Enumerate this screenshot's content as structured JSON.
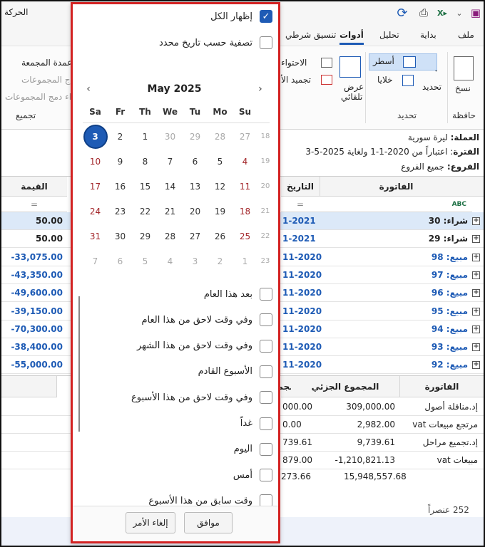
{
  "app": {
    "title_fragment": "الحركة"
  },
  "tabs": [
    "ملف",
    "بداية",
    "تحليل",
    "أدوات",
    "تنسيق شرطي"
  ],
  "active_tab": "أدوات",
  "ribbon": {
    "copy": "نسخ",
    "copy_group": "حافظة",
    "select": "تحديد",
    "rows": "أسطر",
    "cells": "خلايا",
    "select_group": "تحديد",
    "autoview_line1": "عرض",
    "autoview_line2": "تلقائي",
    "contain": "الاحتواء",
    "freeze": "تجميد الأ",
    "group_col": "عمدة المجمعة",
    "collapse_groups": "ج المجموعات",
    "unmerge_groups": "اء دمج المجموعات",
    "group_label": "تجميع"
  },
  "info": {
    "currency_label": "العملة:",
    "currency_value": "ليرة سورية",
    "period_label": "الفترة",
    "period_value": ": اعتباراً من 2020-1-1 ولغاية 2025-5-3",
    "branches_label": "الفروع:",
    "branches_value": "جميع الفروع"
  },
  "grid": {
    "headers": {
      "invoice": "الفاتورة",
      "date": "التاريخ",
      "value": "القيمة"
    },
    "filter_symbol": "=",
    "rows": [
      {
        "invoice": "شراء: 30",
        "date": "1-2021",
        "value": "50.00",
        "selected": true,
        "kind": "buy"
      },
      {
        "invoice": "شراء: 29",
        "date": "1-2021",
        "value": "50.00",
        "selected": false,
        "kind": "buy"
      },
      {
        "invoice": "مبيع: 98",
        "date": "11-2020",
        "value": "-33,075.00",
        "selected": false,
        "kind": "sale"
      },
      {
        "invoice": "مبيع: 97",
        "date": "11-2020",
        "value": "-43,350.00",
        "selected": false,
        "kind": "sale"
      },
      {
        "invoice": "مبيع: 96",
        "date": "11-2020",
        "value": "-49,600.00",
        "selected": false,
        "kind": "sale"
      },
      {
        "invoice": "مبيع: 95",
        "date": "11-2020",
        "value": "-39,150.00",
        "selected": false,
        "kind": "sale"
      },
      {
        "invoice": "مبيع: 94",
        "date": "11-2020",
        "value": "-70,300.00",
        "selected": false,
        "kind": "sale"
      },
      {
        "invoice": "مبيع: 93",
        "date": "11-2020",
        "value": "-38,400.00",
        "selected": false,
        "kind": "sale"
      },
      {
        "invoice": "مبيع: 92",
        "date": "11-2020",
        "value": "-55,000.00",
        "selected": false,
        "kind": "sale"
      }
    ]
  },
  "summary": {
    "headers": {
      "invoice": "الفاتورة",
      "subtotal": "المجموع الجزئي",
      "total_frag": "مجم"
    },
    "rows": [
      {
        "invoice": "إد.مناقلة أصول",
        "subtotal": "309,000.00",
        "total": "000.00"
      },
      {
        "invoice": "مرتجع مبيعات vat",
        "subtotal": "2,982.00",
        "total": "0.00"
      },
      {
        "invoice": "إد.تجميع مراحل",
        "subtotal": "9,739.61",
        "total": "739.61"
      },
      {
        "invoice": "مبيعات vat",
        "subtotal": "-1,210,821.13",
        "total": "879.00"
      }
    ],
    "grand_subtotal": "15,948,557.68",
    "grand_total": "273.66"
  },
  "status": "252 عنصراً",
  "popup": {
    "show_all": "إظهار الكل",
    "filter_by_date": "تصفية حسب تاريخ محدد",
    "calendar": {
      "month": "May 2025",
      "days_of_week": [
        "Sa",
        "Fr",
        "Th",
        "We",
        "Tu",
        "Mo",
        "Su"
      ],
      "weeks": [
        {
          "wk": "18",
          "days": [
            "3",
            "2",
            "1",
            "30",
            "29",
            "28",
            "27"
          ]
        },
        {
          "wk": "19",
          "days": [
            "10",
            "9",
            "8",
            "7",
            "6",
            "5",
            "4"
          ]
        },
        {
          "wk": "20",
          "days": [
            "17",
            "16",
            "15",
            "14",
            "13",
            "12",
            "11"
          ]
        },
        {
          "wk": "21",
          "days": [
            "24",
            "23",
            "22",
            "21",
            "20",
            "19",
            "18"
          ]
        },
        {
          "wk": "22",
          "days": [
            "31",
            "30",
            "29",
            "28",
            "27",
            "26",
            "25"
          ]
        },
        {
          "wk": "23",
          "days": [
            "7",
            "6",
            "5",
            "4",
            "3",
            "2",
            "1"
          ]
        }
      ],
      "selected_day": "3"
    },
    "options": [
      "بعد هذا العام",
      "وفي وقت لاحق من هذا العام",
      "وفي وقت لاحق من هذا الشهر",
      "الأسبوع القادم",
      "وفي وقت لاحق من هذا الأسبوع",
      "غداً",
      "اليوم",
      "أمس",
      "وقت سابق من هذا الأسبوع"
    ],
    "ok": "موافق",
    "cancel": "إلغاء الأمر"
  }
}
